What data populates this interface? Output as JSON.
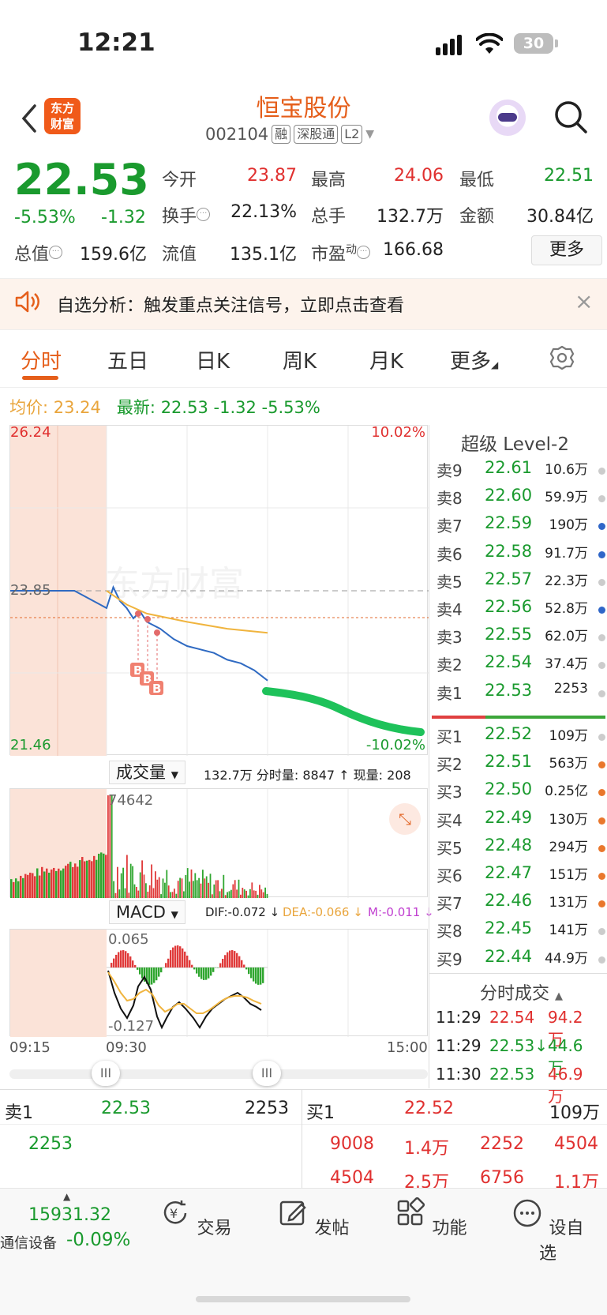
{
  "status_bar": {
    "time": "12:21",
    "battery": "30"
  },
  "header": {
    "logo": "东方\n财富",
    "stock_name": "恒宝股份",
    "code": "002104",
    "tags": [
      "融",
      "深股通",
      "L2"
    ]
  },
  "quote": {
    "price": "22.53",
    "pct_change": "-5.53%",
    "change": "-1.32",
    "fields": [
      {
        "label": "今开",
        "value": "23.87",
        "color": "red"
      },
      {
        "label": "最高",
        "value": "24.06",
        "color": "red"
      },
      {
        "label": "最低",
        "value": "22.51",
        "color": "green"
      },
      {
        "label": "换手",
        "value": "22.13%",
        "color": "black"
      },
      {
        "label": "总手",
        "value": "132.7万",
        "color": "black"
      },
      {
        "label": "金额",
        "value": "30.84亿",
        "color": "black"
      },
      {
        "label": "总值",
        "value": "159.6亿",
        "color": "black"
      },
      {
        "label": "流值",
        "value": "135.1亿",
        "color": "black"
      },
      {
        "label": "市盈",
        "value": "166.68",
        "color": "black"
      }
    ],
    "pe_superscript": "动",
    "more_label": "更多"
  },
  "notice": {
    "text": "自选分析：触发重点关注信号，立即点击查看",
    "close": "×"
  },
  "tabs": [
    "分时",
    "五日",
    "日K",
    "周K",
    "月K",
    "更多",
    ""
  ],
  "legend": {
    "avg_label": "均价:",
    "avg_value": "23.24",
    "latest_label": "最新:",
    "latest_value": "22.53",
    "latest_change": "-1.32",
    "latest_pct": "-5.53%"
  },
  "chart": {
    "y_max": "26.24",
    "y_min": "21.46",
    "y_ref": "23.85",
    "pct_max": "10.02%",
    "pct_min": "-10.02%",
    "marker_label": "B",
    "watermark": "东方财富",
    "vol_selector": "成交量",
    "vol_info": "132.7万 分时量: 8847 ↑ 现量: 208",
    "vol_max": "74642",
    "macd_selector": "MACD",
    "macd_dif": "DIF:-0.072 ↓",
    "macd_dea": "DEA:-0.066 ↓",
    "macd_m": "M:-0.011 ↓",
    "macd_max": "0.065",
    "macd_min": "-0.127",
    "time_start": "09:15",
    "time_mid": "09:30",
    "time_end": "15:00",
    "slider_handle": "III"
  },
  "chart_data": {
    "type": "line",
    "series": [
      {
        "name": "最新",
        "x": [
          "09:15",
          "09:25",
          "09:30",
          "09:35",
          "09:40",
          "09:45",
          "09:50",
          "09:55",
          "10:00",
          "10:10",
          "10:20",
          "10:30",
          "10:40",
          "10:50",
          "11:00",
          "11:10",
          "11:20",
          "11:30"
        ],
        "values": [
          23.85,
          23.85,
          23.6,
          23.9,
          23.7,
          23.6,
          23.45,
          23.55,
          23.4,
          23.3,
          23.15,
          23.05,
          23.0,
          22.95,
          22.85,
          22.8,
          22.7,
          22.55
        ]
      },
      {
        "name": "均价",
        "x": [
          "09:30",
          "09:45",
          "10:00",
          "10:30",
          "11:00",
          "11:30"
        ],
        "values": [
          23.85,
          23.65,
          23.52,
          23.4,
          23.3,
          23.24
        ]
      }
    ],
    "ylim": [
      21.46,
      26.24
    ]
  },
  "order_book": {
    "title": "超级 Level-2",
    "asks": [
      {
        "side": "卖9",
        "price": "22.61",
        "vol": "10.6万",
        "dot": "#cccccc"
      },
      {
        "side": "卖8",
        "price": "22.60",
        "vol": "59.9万",
        "dot": "#cccccc"
      },
      {
        "side": "卖7",
        "price": "22.59",
        "vol": "190万",
        "dot": "#2f66c8"
      },
      {
        "side": "卖6",
        "price": "22.58",
        "vol": "91.7万",
        "dot": "#2f66c8"
      },
      {
        "side": "卖5",
        "price": "22.57",
        "vol": "22.3万",
        "dot": "#cccccc"
      },
      {
        "side": "卖4",
        "price": "22.56",
        "vol": "52.8万",
        "dot": "#2f66c8"
      },
      {
        "side": "卖3",
        "price": "22.55",
        "vol": "62.0万",
        "dot": "#cccccc"
      },
      {
        "side": "卖2",
        "price": "22.54",
        "vol": "37.4万",
        "dot": "#cccccc"
      },
      {
        "side": "卖1",
        "price": "22.53",
        "vol": "2253",
        "dot": "#cccccc"
      }
    ],
    "bids": [
      {
        "side": "买1",
        "price": "22.52",
        "vol": "109万",
        "dot": "#cccccc"
      },
      {
        "side": "买2",
        "price": "22.51",
        "vol": "563万",
        "dot": "#e9772c"
      },
      {
        "side": "买3",
        "price": "22.50",
        "vol": "0.25亿",
        "dot": "#e9772c"
      },
      {
        "side": "买4",
        "price": "22.49",
        "vol": "130万",
        "dot": "#e9772c"
      },
      {
        "side": "买5",
        "price": "22.48",
        "vol": "294万",
        "dot": "#e9772c"
      },
      {
        "side": "买6",
        "price": "22.47",
        "vol": "151万",
        "dot": "#e9772c"
      },
      {
        "side": "买7",
        "price": "22.46",
        "vol": "131万",
        "dot": "#e9772c"
      },
      {
        "side": "买8",
        "price": "22.45",
        "vol": "141万",
        "dot": "#cccccc"
      },
      {
        "side": "买9",
        "price": "22.44",
        "vol": "44.9万",
        "dot": "#cccccc"
      }
    ]
  },
  "trades": {
    "title": "分时成交",
    "rows": [
      {
        "time": "11:29",
        "price": "22.54",
        "vol": "94.2万",
        "color": "red"
      },
      {
        "time": "11:29",
        "price": "22.53↓",
        "vol": "44.6万",
        "color": "green"
      },
      {
        "time": "11:30",
        "price": "22.53",
        "vol": "46.9万",
        "color": "red"
      }
    ]
  },
  "bottom_book": {
    "sell_label": "卖1",
    "sell_price": "22.53",
    "sell_vol": "2253",
    "sell_detail": "2253",
    "buy_label": "买1",
    "buy_price": "22.52",
    "buy_vol": "109万",
    "buy_detail_row1": [
      "9008",
      "1.4万",
      "2252",
      "4504"
    ],
    "buy_detail_row2": [
      "4504",
      "2.5万",
      "6756",
      "1.1万"
    ]
  },
  "tabbar": {
    "index_value": "15931.32",
    "index_name": "通信设备",
    "index_pct": "-0.09%",
    "items": [
      "交易",
      "发帖",
      "功能",
      "设自选"
    ]
  }
}
